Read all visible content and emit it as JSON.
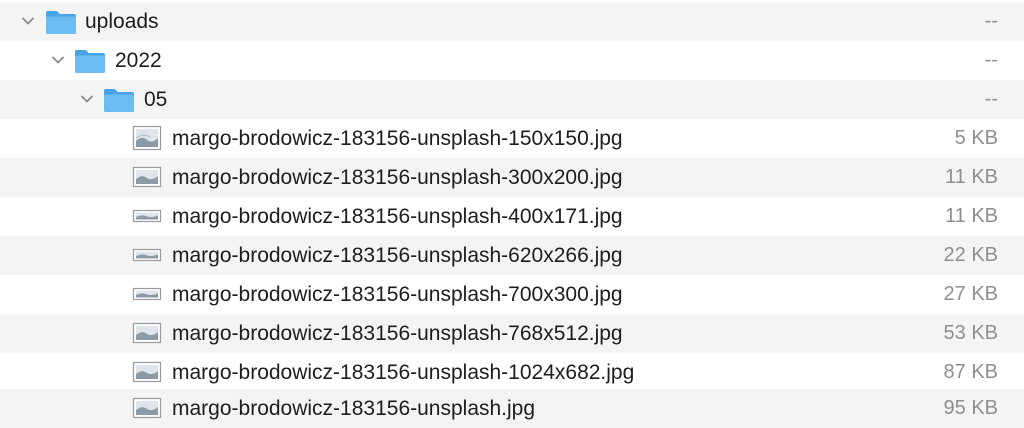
{
  "folders": [
    {
      "name": "uploads",
      "size": "--",
      "icon": "folder-icon",
      "expanded": true
    },
    {
      "name": "2022",
      "size": "--",
      "icon": "folder-icon",
      "expanded": true
    },
    {
      "name": "05",
      "size": "--",
      "icon": "folder-icon",
      "expanded": true
    }
  ],
  "files": [
    {
      "name": "margo-brodowicz-183156-unsplash-150x150.jpg",
      "size": "5 KB",
      "icon": "image-file-icon"
    },
    {
      "name": "margo-brodowicz-183156-unsplash-300x200.jpg",
      "size": "11 KB",
      "icon": "image-file-icon"
    },
    {
      "name": "margo-brodowicz-183156-unsplash-400x171.jpg",
      "size": "11 KB",
      "icon": "image-file-icon"
    },
    {
      "name": "margo-brodowicz-183156-unsplash-620x266.jpg",
      "size": "22 KB",
      "icon": "image-file-icon"
    },
    {
      "name": "margo-brodowicz-183156-unsplash-700x300.jpg",
      "size": "27 KB",
      "icon": "image-file-icon"
    },
    {
      "name": "margo-brodowicz-183156-unsplash-768x512.jpg",
      "size": "53 KB",
      "icon": "image-file-icon"
    },
    {
      "name": "margo-brodowicz-183156-unsplash-1024x682.jpg",
      "size": "87 KB",
      "icon": "image-file-icon"
    },
    {
      "name": "margo-brodowicz-183156-unsplash.jpg",
      "size": "95 KB",
      "icon": "image-file-icon"
    }
  ],
  "colors": {
    "folder_blue": "#5fb4f0",
    "stripe": "#f4f4f5",
    "text": "#1d1d1f",
    "secondary_text": "#8e8e93"
  }
}
